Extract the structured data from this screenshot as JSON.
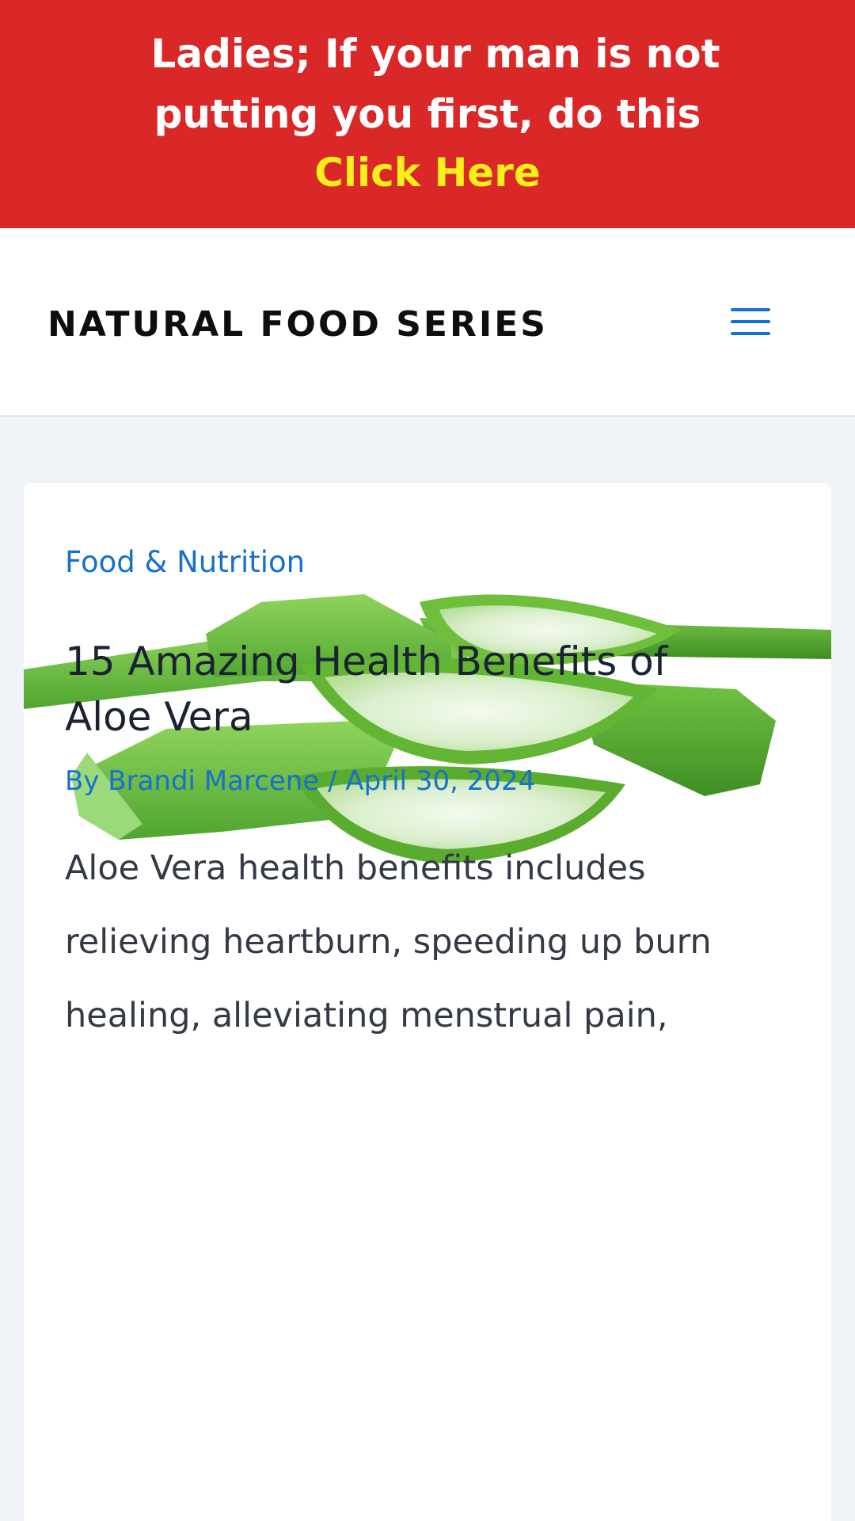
{
  "promo": {
    "line1": "Ladies; If your man is not",
    "line2": "putting you first, do this",
    "cta": "Click Here",
    "background_color": "#da2727",
    "cta_color": "#f9ef1a"
  },
  "header": {
    "site_title": "NATURAL FOOD SERIES",
    "menu_icon": "hamburger-menu-icon",
    "accent_color": "#1670d1"
  },
  "post": {
    "image_alt_icon": "aloe-vera-image",
    "category": "Food & Nutrition",
    "title": "15 Amazing Health Benefits of Aloe Vera",
    "meta_by": "By",
    "author": "Brandi Marcene",
    "separator": "/",
    "date": "April 30, 2024",
    "excerpt": "Aloe Vera health benefits includes relieving heartburn, speeding up burn healing, alleviating menstrual pain,"
  }
}
